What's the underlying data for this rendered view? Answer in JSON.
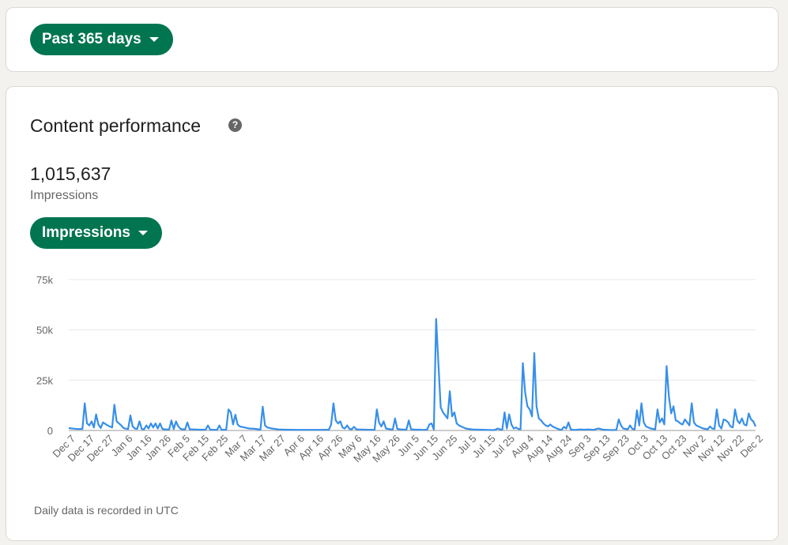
{
  "range_selector": {
    "label": "Past 365 days"
  },
  "content": {
    "title": "Content performance",
    "total": "1,015,637",
    "total_label": "Impressions",
    "metric_selector": "Impressions",
    "footnote": "Daily data is recorded in UTC",
    "help_icon": "?"
  },
  "colors": {
    "accent": "#01754f",
    "line": "#378fe9",
    "grid": "#e8e8e8"
  },
  "chart_data": {
    "type": "line",
    "title": "",
    "xlabel": "",
    "ylabel": "",
    "ylim": [
      0,
      75000
    ],
    "yticks": [
      0,
      25000,
      50000,
      75000
    ],
    "ytick_labels": [
      "0",
      "25k",
      "50k",
      "75k"
    ],
    "grid": true,
    "xtick_labels": [
      "Dec 7",
      "Dec 17",
      "Dec 27",
      "Jan 6",
      "Jan 16",
      "Jan 26",
      "Feb 5",
      "Feb 15",
      "Feb 25",
      "Mar 7",
      "Mar 17",
      "Mar 27",
      "Apr 6",
      "Apr 16",
      "Apr 26",
      "May 6",
      "May 16",
      "May 26",
      "Jun 5",
      "Jun 15",
      "Jun 25",
      "Jul 5",
      "Jul 15",
      "Jul 25",
      "Aug 4",
      "Aug 14",
      "Aug 24",
      "Sep 3",
      "Sep 13",
      "Sep 23",
      "Oct 3",
      "Oct 13",
      "Oct 23",
      "Nov 2",
      "Nov 12",
      "Nov 22",
      "Dec 2"
    ],
    "series": [
      {
        "points": [
          [
            0,
            1200
          ],
          [
            2,
            900
          ],
          [
            4,
            700
          ],
          [
            6,
            800
          ],
          [
            7,
            13500
          ],
          [
            8,
            3500
          ],
          [
            9,
            2500
          ],
          [
            10,
            4500
          ],
          [
            11,
            1500
          ],
          [
            12,
            8000
          ],
          [
            13,
            3000
          ],
          [
            14,
            1200
          ],
          [
            15,
            4000
          ],
          [
            17,
            2500
          ],
          [
            19,
            1500
          ],
          [
            20,
            12800
          ],
          [
            21,
            4500
          ],
          [
            22,
            3500
          ],
          [
            23,
            2500
          ],
          [
            24,
            1200
          ],
          [
            25,
            900
          ],
          [
            26,
            700
          ],
          [
            27,
            7500
          ],
          [
            28,
            2000
          ],
          [
            29,
            1000
          ],
          [
            30,
            800
          ],
          [
            31,
            4500
          ],
          [
            32,
            700
          ],
          [
            33,
            600
          ],
          [
            34,
            2500
          ],
          [
            35,
            1000
          ],
          [
            36,
            3500
          ],
          [
            37,
            1500
          ],
          [
            38,
            3500
          ],
          [
            39,
            1000
          ],
          [
            40,
            3500
          ],
          [
            41,
            800
          ],
          [
            42,
            600
          ],
          [
            43,
            500
          ],
          [
            44,
            500
          ],
          [
            45,
            5000
          ],
          [
            46,
            700
          ],
          [
            47,
            4500
          ],
          [
            48,
            2000
          ],
          [
            49,
            800
          ],
          [
            50,
            600
          ],
          [
            51,
            500
          ],
          [
            52,
            4000
          ],
          [
            53,
            600
          ],
          [
            55,
            500
          ],
          [
            57,
            400
          ],
          [
            60,
            400
          ],
          [
            61,
            2500
          ],
          [
            62,
            400
          ],
          [
            65,
            300
          ],
          [
            66,
            2500
          ],
          [
            67,
            300
          ],
          [
            69,
            400
          ],
          [
            70,
            10500
          ],
          [
            71,
            9000
          ],
          [
            72,
            3000
          ],
          [
            73,
            7800
          ],
          [
            74,
            3000
          ],
          [
            75,
            2000
          ],
          [
            77,
            1500
          ],
          [
            79,
            1000
          ],
          [
            82,
            800
          ],
          [
            84,
            400
          ],
          [
            85,
            11800
          ],
          [
            86,
            2500
          ],
          [
            87,
            1500
          ],
          [
            89,
            1000
          ],
          [
            92,
            500
          ],
          [
            95,
            400
          ],
          [
            100,
            300
          ],
          [
            105,
            300
          ],
          [
            110,
            300
          ],
          [
            114,
            400
          ],
          [
            115,
            3000
          ],
          [
            116,
            13500
          ],
          [
            117,
            5000
          ],
          [
            118,
            3500
          ],
          [
            119,
            4500
          ],
          [
            120,
            1500
          ],
          [
            121,
            1000
          ],
          [
            122,
            2500
          ],
          [
            123,
            800
          ],
          [
            124,
            600
          ],
          [
            125,
            1800
          ],
          [
            126,
            600
          ],
          [
            127,
            500
          ],
          [
            130,
            400
          ],
          [
            134,
            300
          ],
          [
            135,
            10500
          ],
          [
            136,
            4000
          ],
          [
            137,
            2000
          ],
          [
            138,
            4500
          ],
          [
            139,
            1000
          ],
          [
            140,
            800
          ],
          [
            141,
            600
          ],
          [
            142,
            500
          ],
          [
            143,
            6000
          ],
          [
            144,
            800
          ],
          [
            145,
            600
          ],
          [
            146,
            500
          ],
          [
            147,
            400
          ],
          [
            148,
            500
          ],
          [
            149,
            5000
          ],
          [
            150,
            600
          ],
          [
            152,
            400
          ],
          [
            154,
            400
          ],
          [
            155,
            300
          ],
          [
            157,
            400
          ],
          [
            158,
            3000
          ],
          [
            159,
            3500
          ],
          [
            160,
            500
          ],
          [
            161,
            55500
          ],
          [
            162,
            33000
          ],
          [
            163,
            11500
          ],
          [
            164,
            9000
          ],
          [
            165,
            7500
          ],
          [
            166,
            6000
          ],
          [
            167,
            19500
          ],
          [
            168,
            7000
          ],
          [
            169,
            9000
          ],
          [
            170,
            3500
          ],
          [
            171,
            2500
          ],
          [
            172,
            2000
          ],
          [
            173,
            1500
          ],
          [
            174,
            1000
          ],
          [
            175,
            800
          ],
          [
            177,
            500
          ],
          [
            180,
            400
          ],
          [
            183,
            300
          ],
          [
            186,
            200
          ],
          [
            187,
            400
          ],
          [
            188,
            1000
          ],
          [
            189,
            500
          ],
          [
            190,
            400
          ],
          [
            191,
            9000
          ],
          [
            192,
            1000
          ],
          [
            193,
            8000
          ],
          [
            194,
            3000
          ],
          [
            195,
            1000
          ],
          [
            196,
            1500
          ],
          [
            197,
            800
          ],
          [
            198,
            600
          ],
          [
            199,
            33500
          ],
          [
            200,
            19000
          ],
          [
            201,
            12000
          ],
          [
            202,
            10500
          ],
          [
            203,
            7000
          ],
          [
            204,
            38500
          ],
          [
            205,
            12000
          ],
          [
            206,
            6000
          ],
          [
            207,
            5000
          ],
          [
            208,
            3500
          ],
          [
            209,
            2500
          ],
          [
            210,
            2000
          ],
          [
            211,
            3000
          ],
          [
            212,
            2000
          ],
          [
            213,
            1500
          ],
          [
            214,
            1000
          ],
          [
            215,
            500
          ],
          [
            216,
            300
          ],
          [
            217,
            1800
          ],
          [
            218,
            1000
          ],
          [
            219,
            4000
          ],
          [
            220,
            600
          ],
          [
            221,
            300
          ],
          [
            222,
            300
          ],
          [
            224,
            500
          ],
          [
            226,
            400
          ],
          [
            228,
            500
          ],
          [
            230,
            300
          ],
          [
            232,
            1000
          ],
          [
            233,
            800
          ],
          [
            234,
            400
          ],
          [
            236,
            300
          ],
          [
            238,
            200
          ],
          [
            240,
            300
          ],
          [
            241,
            5500
          ],
          [
            242,
            2500
          ],
          [
            243,
            1000
          ],
          [
            244,
            800
          ],
          [
            245,
            600
          ],
          [
            246,
            2500
          ],
          [
            247,
            800
          ],
          [
            248,
            600
          ],
          [
            249,
            10000
          ],
          [
            250,
            2500
          ],
          [
            251,
            13500
          ],
          [
            252,
            4000
          ],
          [
            253,
            2000
          ],
          [
            254,
            1500
          ],
          [
            255,
            1000
          ],
          [
            256,
            800
          ],
          [
            257,
            600
          ],
          [
            258,
            10500
          ],
          [
            259,
            4000
          ],
          [
            260,
            6000
          ],
          [
            261,
            3000
          ],
          [
            262,
            32000
          ],
          [
            263,
            17000
          ],
          [
            264,
            8500
          ],
          [
            265,
            12000
          ],
          [
            266,
            5000
          ],
          [
            267,
            4500
          ],
          [
            268,
            3500
          ],
          [
            269,
            3000
          ],
          [
            270,
            5500
          ],
          [
            271,
            4000
          ],
          [
            272,
            2500
          ],
          [
            273,
            13500
          ],
          [
            274,
            4000
          ],
          [
            275,
            2500
          ],
          [
            276,
            2000
          ],
          [
            277,
            1500
          ],
          [
            278,
            1000
          ],
          [
            279,
            800
          ],
          [
            280,
            600
          ],
          [
            281,
            2000
          ],
          [
            282,
            1000
          ],
          [
            283,
            800
          ],
          [
            284,
            10500
          ],
          [
            285,
            2500
          ],
          [
            286,
            1000
          ],
          [
            287,
            5500
          ],
          [
            288,
            5000
          ],
          [
            289,
            4000
          ],
          [
            290,
            2000
          ],
          [
            291,
            1500
          ],
          [
            292,
            10500
          ],
          [
            293,
            5000
          ],
          [
            294,
            3500
          ],
          [
            295,
            6000
          ],
          [
            296,
            3000
          ],
          [
            297,
            2500
          ],
          [
            298,
            8500
          ],
          [
            299,
            5500
          ],
          [
            300,
            4500
          ],
          [
            301,
            2000
          ]
        ]
      }
    ]
  }
}
